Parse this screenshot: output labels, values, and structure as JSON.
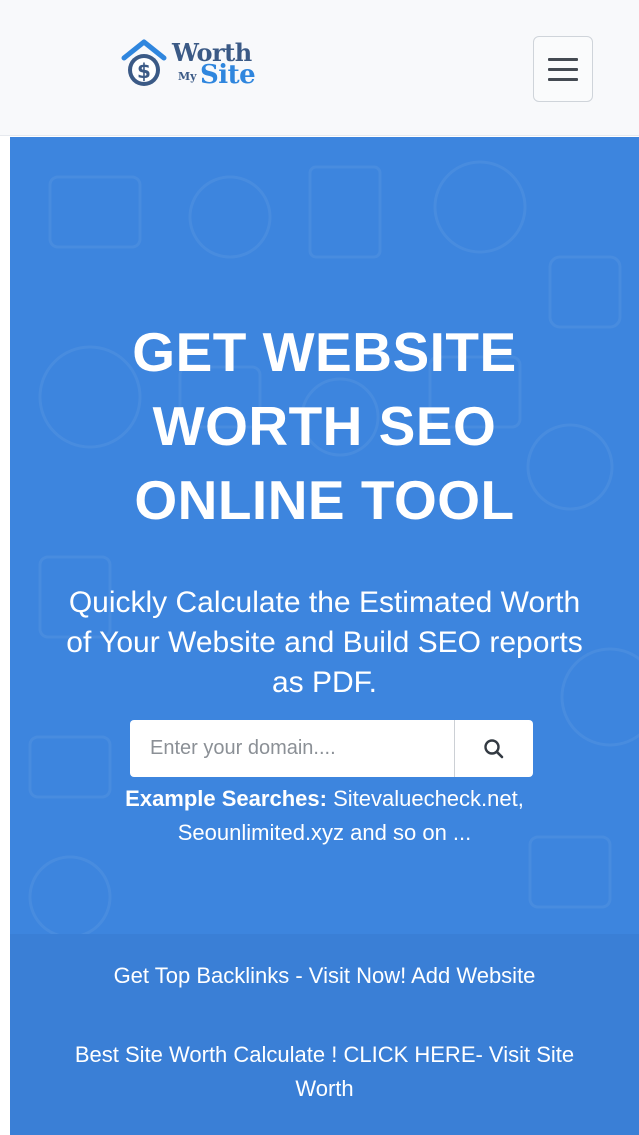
{
  "navbar": {
    "logo": {
      "word_worth": "Worth",
      "word_my": "My",
      "word_site": "Site",
      "icon": "dollar-house-icon"
    },
    "menu_icon": "hamburger-menu-icon"
  },
  "hero": {
    "title_lines": [
      "GET WEBSITE",
      "WORTH SEO",
      "ONLINE TOOL"
    ],
    "subtitle_lines": [
      "Quickly Calculate the Estimated Worth",
      "of Your Website and Build SEO reports",
      "as PDF."
    ],
    "search": {
      "placeholder": "Enter your domain....",
      "value": "",
      "button_icon": "search-icon"
    },
    "examples": {
      "label": "Example Searches:",
      "line1_rest": "Sitevaluecheck.net,",
      "line2": "Seounlimited.xyz and so on ..."
    }
  },
  "links": {
    "line1": "Get Top Backlinks - Visit Now! Add Website",
    "line2a": "Best Site Worth Calculate ! CLICK HERE- Visit Site",
    "line2b": "Worth"
  },
  "colors": {
    "hero_bg": "#3d85de",
    "band_bg": "#3a7fd6",
    "navbar_bg": "#f8f9fb",
    "logo_dark": "#3b5a86",
    "logo_accent": "#2f86de"
  }
}
